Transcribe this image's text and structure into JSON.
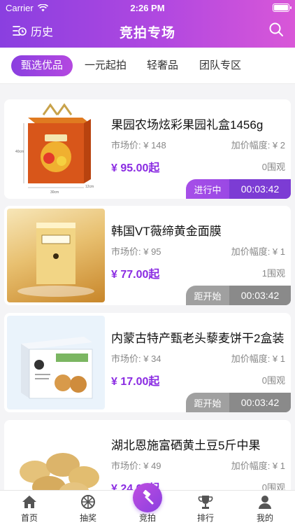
{
  "status_bar": {
    "carrier": "Carrier",
    "time": "2:26 PM"
  },
  "nav": {
    "history_label": "历史",
    "title": "竞拍专场"
  },
  "tabs": [
    {
      "label": "甄选优品",
      "active": true
    },
    {
      "label": "一元起拍",
      "active": false
    },
    {
      "label": "轻奢品",
      "active": false
    },
    {
      "label": "团队专区",
      "active": false
    }
  ],
  "products": [
    {
      "name": "果园农场炫彩果园礼盒1456g",
      "market_price": "市场价: ¥ 148",
      "increase": "加价幅度: ¥ 2",
      "start_price": "¥ 95.00起",
      "watchers": "0围观",
      "status": "进行中",
      "timer": "00:03:42",
      "image": "fruit-gift-box-image",
      "dims": [
        "40cm",
        "30cm",
        "12cm"
      ]
    },
    {
      "name": "韩国VT薇缔黄金面膜",
      "market_price": "市场价: ¥ 95",
      "increase": "加价幅度: ¥ 1",
      "start_price": "¥ 77.00起",
      "watchers": "1围观",
      "status": "距开始",
      "timer": "00:03:42",
      "image": "gold-mask-box-image"
    },
    {
      "name": "内蒙古特产甄老头藜麦饼干2盒装",
      "market_price": "市场价: ¥ 34",
      "increase": "加价幅度: ¥ 1",
      "start_price": "¥ 17.00起",
      "watchers": "0围观",
      "status": "距开始",
      "timer": "00:03:42",
      "image": "quinoa-biscuit-box-image"
    },
    {
      "name": "湖北恩施富硒黄土豆5斤中果",
      "market_price": "市场价: ¥ 49",
      "increase": "加价幅度: ¥ 1",
      "start_price": "¥ 24.00起",
      "watchers": "0围观",
      "image": "potatoes-image"
    }
  ],
  "bottom_nav": [
    {
      "label": "首页",
      "icon": "home-icon"
    },
    {
      "label": "抽奖",
      "icon": "lottery-icon"
    },
    {
      "label": "竞拍",
      "icon": "auction-hammer-icon",
      "active": true
    },
    {
      "label": "排行",
      "icon": "trophy-icon"
    },
    {
      "label": "我的",
      "icon": "user-icon"
    }
  ],
  "colors": {
    "accent": "#8a3fe0",
    "accent_pink": "#d957d8",
    "price": "#8a2be2"
  }
}
